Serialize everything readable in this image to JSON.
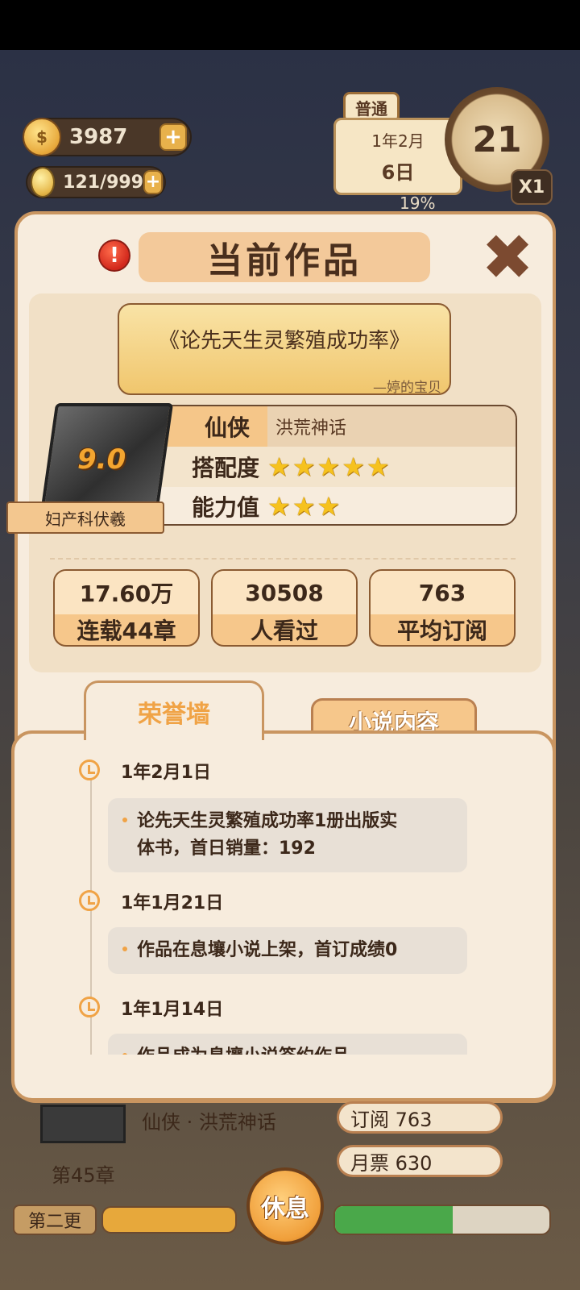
{
  "hud": {
    "coins": "3987",
    "inspiration": "121/999",
    "mode": "普通",
    "date_line1": "1年2月",
    "date_line2": "6日",
    "day_counter": "21",
    "speed": "X1",
    "energy_percent_text": "19%"
  },
  "modal": {
    "title": "当前作品",
    "book_title": "《论先天生灵繁殖成功率》",
    "author": "—婷的宝贝",
    "cover_score": "9.0",
    "cover_banner": "妇产科伏羲",
    "genre_main": "仙侠",
    "genre_sub": "洪荒神话",
    "match_label": "搭配度",
    "match_stars": 5,
    "ability_label": "能力值",
    "ability_stars": 3,
    "stats": [
      {
        "value": "17.60万",
        "label": "连载44章"
      },
      {
        "value": "30508",
        "label": "人看过"
      },
      {
        "value": "763",
        "label": "平均订阅"
      }
    ],
    "tabs": {
      "honor": "荣誉墙",
      "content": "小说内容"
    },
    "timeline": [
      {
        "date": "1年2月1日",
        "text_line1": "论先天生灵繁殖成功率1册出版实",
        "text_line2": "体书，首日销量：192"
      },
      {
        "date": "1年1月21日",
        "text_line1": "作品在息壤小说上架，首订成绩0"
      },
      {
        "date": "1年1月14日",
        "text_line1": "作品成为息壤小说签约作品"
      }
    ]
  },
  "bottom": {
    "genre_line": "仙侠 · 洪荒神话",
    "subscribe": "订阅 763",
    "monthly_ticket": "月票 630",
    "chapter": "第45章",
    "update_btn": "第二更",
    "rest_btn": "休息",
    "right_progress": 0.55,
    "close_glyph": "✖"
  },
  "colors": {
    "accent_orange": "#f0a346",
    "star_yellow": "#f6c21e",
    "panel_bg": "#f7ecdd",
    "border_brown": "#c99560"
  }
}
